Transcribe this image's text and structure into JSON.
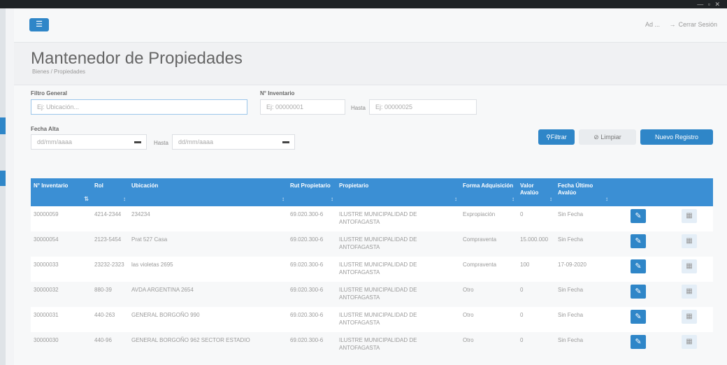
{
  "header": {
    "user": "Ad ... ",
    "logout_icon": "→",
    "logout_label": "Cerrar Sesión"
  },
  "page": {
    "title": "Mantenedor de Propiedades",
    "breadcrumb": "Bienes / Propiedades"
  },
  "filters": {
    "general_label": "Filtro General",
    "general_placeholder": "Ej: Ubicación...",
    "inventario_label": "N° Inventario",
    "inventario_placeholder": "Ej: 00000001",
    "hasta_label": "Hasta",
    "inventario_hasta_placeholder": "Ej: 00000025",
    "fecha_label": "Fecha Alta",
    "fecha_desde": "dd/mm/aaaa",
    "fecha_hasta": "dd/mm/aaaa",
    "calendar_icon": "calendar-icon"
  },
  "buttons": {
    "filtrar": "Filtrar",
    "limpiar": "Limpiar",
    "nuevo": "Nuevo Registro"
  },
  "table": {
    "headers": [
      "N° Inventario",
      "Rol",
      "Ubicación",
      "Rut Propietario",
      "Propietario",
      "Forma Adquisición",
      "Valor Avalúo",
      "Fecha Último Avalúo"
    ],
    "rows": [
      {
        "inv": "30000059",
        "rol": "4214-2344",
        "ubic": "234234",
        "rut": "69.020.300-6",
        "prop": "ILUSTRE MUNICIPALIDAD DE ANTOFAGASTA",
        "forma": "Expropiación",
        "valor": "0",
        "fecha": "Sin Fecha"
      },
      {
        "inv": "30000054",
        "rol": "2123-5454",
        "ubic": "Prat 527 Casa",
        "rut": "69.020.300-6",
        "prop": "ILUSTRE MUNICIPALIDAD DE ANTOFAGASTA",
        "forma": "Compraventa",
        "valor": "15.000.000",
        "fecha": "Sin Fecha"
      },
      {
        "inv": "30000033",
        "rol": "23232-2323",
        "ubic": "las violetas 2695",
        "rut": "69.020.300-6",
        "prop": "ILUSTRE MUNICIPALIDAD DE ANTOFAGASTA",
        "forma": "Compraventa",
        "valor": "100",
        "fecha": "17-09-2020"
      },
      {
        "inv": "30000032",
        "rol": "880-39",
        "ubic": "AVDA ARGENTINA 2654",
        "rut": "69.020.300-6",
        "prop": "ILUSTRE MUNICIPALIDAD DE ANTOFAGASTA",
        "forma": "Otro",
        "valor": "0",
        "fecha": "Sin Fecha"
      },
      {
        "inv": "30000031",
        "rol": "440-263",
        "ubic": "GENERAL BORGOÑO 990",
        "rut": "69.020.300-6",
        "prop": "ILUSTRE MUNICIPALIDAD DE ANTOFAGASTA",
        "forma": "Otro",
        "valor": "0",
        "fecha": "Sin Fecha"
      },
      {
        "inv": "30000030",
        "rol": "440-96",
        "ubic": "GENERAL BORGOÑO 962 SECTOR ESTADIO",
        "rut": "69.020.300-6",
        "prop": "ILUSTRE MUNICIPALIDAD DE ANTOFAGASTA",
        "forma": "Otro",
        "valor": "0",
        "fecha": "Sin Fecha"
      }
    ]
  },
  "colors": {
    "accent": "#2f86c8",
    "table_header": "#3b8fd4"
  }
}
